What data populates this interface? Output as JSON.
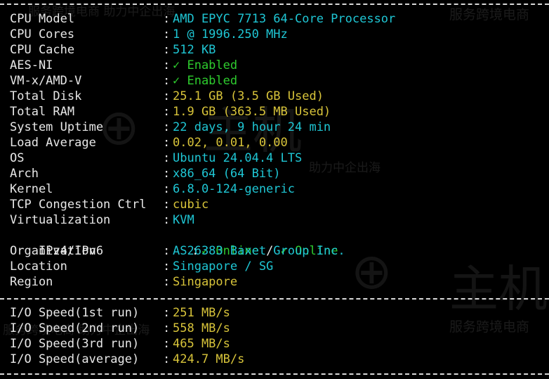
{
  "system": [
    {
      "label": "CPU Model",
      "value": "AMD EPYC 7713 64-Core Processor",
      "color": "cyan"
    },
    {
      "label": "CPU Cores",
      "value": "1 @ 1996.250 MHz",
      "color": "cyan"
    },
    {
      "label": "CPU Cache",
      "value": "512 KB",
      "color": "cyan"
    },
    {
      "label": "AES-NI",
      "value": "✓ Enabled",
      "color": "green"
    },
    {
      "label": "VM-x/AMD-V",
      "value": "✓ Enabled",
      "color": "green"
    },
    {
      "label": "Total Disk",
      "value": "25.1 GB (3.5 GB Used)",
      "color": "yellow"
    },
    {
      "label": "Total RAM",
      "value": "1.9 GB (363.5 MB Used)",
      "color": "yellow"
    },
    {
      "label": "System Uptime",
      "value": "22 days, 9 hour 24 min",
      "color": "cyan"
    },
    {
      "label": "Load Average",
      "value": "0.02, 0.01, 0.00",
      "color": "yellow"
    },
    {
      "label": "OS",
      "value": "Ubuntu 24.04.4 LTS",
      "color": "cyan"
    },
    {
      "label": "Arch",
      "value": "x86_64 (64 Bit)",
      "color": "cyan"
    },
    {
      "label": "Kernel",
      "value": "6.8.0-124-generic",
      "color": "cyan"
    },
    {
      "label": "TCP Congestion Ctrl",
      "value": "cubic",
      "color": "yellow"
    },
    {
      "label": "Virtualization",
      "value": "KVM",
      "color": "cyan"
    }
  ],
  "ipv": {
    "label": "IPv4/IPv6",
    "v4": "✓ Online",
    "sep": "/",
    "v6": "✓ Online"
  },
  "network": [
    {
      "label": "Organization",
      "value": "AS26383 Baxet Group Inc.",
      "color": "cyan"
    },
    {
      "label": "Location",
      "value": "Singapore / SG",
      "color": "cyan"
    },
    {
      "label": "Region",
      "value": "Singapore",
      "color": "yellow"
    }
  ],
  "io": [
    {
      "label": "I/O Speed(1st run)",
      "value": "251 MB/s",
      "color": "yellow"
    },
    {
      "label": "I/O Speed(2nd run)",
      "value": "558 MB/s",
      "color": "yellow"
    },
    {
      "label": "I/O Speed(3rd run)",
      "value": "465 MB/s",
      "color": "yellow"
    },
    {
      "label": "I/O Speed(average)",
      "value": "424.7 MB/s",
      "color": "yellow"
    }
  ],
  "colon": ":",
  "watermark": {
    "text1": "服务跨境电商 助力中企出海",
    "text2": "服务跨境电商",
    "text3": "主机",
    "text4": "助力中企出海",
    "text5": "主机"
  },
  "colors": {
    "cyan": "#1fc6d4",
    "yellow": "#d8c43a",
    "green": "#2ecc2e",
    "text": "#e8e8e8",
    "bg": "#000000"
  }
}
